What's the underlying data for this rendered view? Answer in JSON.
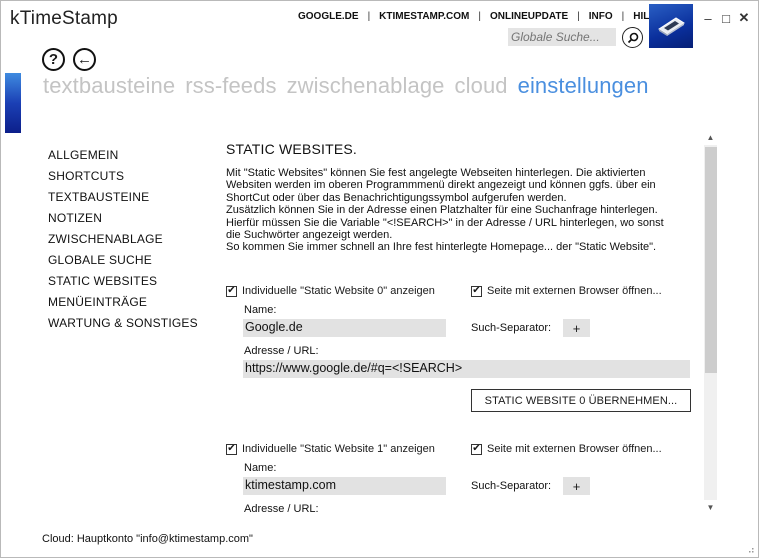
{
  "app": {
    "title": "kTimeStamp"
  },
  "toplinks": [
    "GOOGLE.DE",
    "KTIMESTAMP.COM",
    "ONLINEUPDATE",
    "INFO",
    "HILFE"
  ],
  "search": {
    "placeholder": "Globale Suche..."
  },
  "window_controls": {
    "minimize": "–",
    "maximize": "□",
    "close": "✕"
  },
  "nav": {
    "help_symbol": "?",
    "back_symbol": "←",
    "tabs": [
      {
        "label": "textbausteine",
        "active": false
      },
      {
        "label": "rss-feeds",
        "active": false
      },
      {
        "label": "zwischenablage",
        "active": false
      },
      {
        "label": "cloud",
        "active": false
      },
      {
        "label": "einstellungen",
        "active": true
      }
    ]
  },
  "sidebar": {
    "items": [
      "ALLGEMEIN",
      "SHORTCUTS",
      "TEXTBAUSTEINE",
      "NOTIZEN",
      "ZWISCHENABLAGE",
      "GLOBALE SUCHE",
      "STATIC WEBSITES",
      "MENÜEINTRÄGE",
      "WARTUNG & SONSTIGES"
    ]
  },
  "content": {
    "title": "STATIC WEBSITES.",
    "description": "Mit \"Static Websites\" können Sie fest angelegte Webseiten hinterlegen. Die aktivierten\nWebsiten werden im oberen Programmmenü direkt angezeigt und können ggfs. über ein\nShortCut oder über das Benachrichtigungssymbol aufgerufen werden.\nZusätzlich können Sie in der Adresse einen Platzhalter für eine Suchanfrage hinterlegen.\nHierfür müssen Sie die Variable \"<!SEARCH>\" in der Adresse / URL hinterlegen, wo sonst\ndie Suchwörter angezeigt werden.\nSo kommen Sie immer schnell an Ihre fest hinterlegte Homepage... der \"Static Website\".",
    "sites": [
      {
        "show_label": "Individuelle \"Static Website 0\" anzeigen",
        "show_checked": true,
        "external_label": "Seite mit externen Browser öffnen...",
        "external_checked": true,
        "name_label": "Name:",
        "name_value": "Google.de",
        "separator_label": "Such-Separator:",
        "separator_value": "+",
        "address_label": "Adresse / URL:",
        "address_value": "https://www.google.de/#q=<!SEARCH>",
        "apply_label": "STATIC WEBSITE 0 ÜBERNEHMEN..."
      },
      {
        "show_label": "Individuelle \"Static Website 1\" anzeigen",
        "show_checked": true,
        "external_label": "Seite mit externen Browser öffnen...",
        "external_checked": true,
        "name_label": "Name:",
        "name_value": "ktimestamp.com",
        "separator_label": "Such-Separator:",
        "separator_value": "+",
        "address_label": "Adresse / URL:"
      }
    ]
  },
  "status": {
    "text": "Cloud: Hauptkonto \"info@ktimestamp.com\""
  },
  "colors": {
    "accent": "#4a8fdf",
    "tile": "#0a2f9c",
    "inactive_tab": "#c4c4c4",
    "field_bg": "#e2e2e2"
  }
}
